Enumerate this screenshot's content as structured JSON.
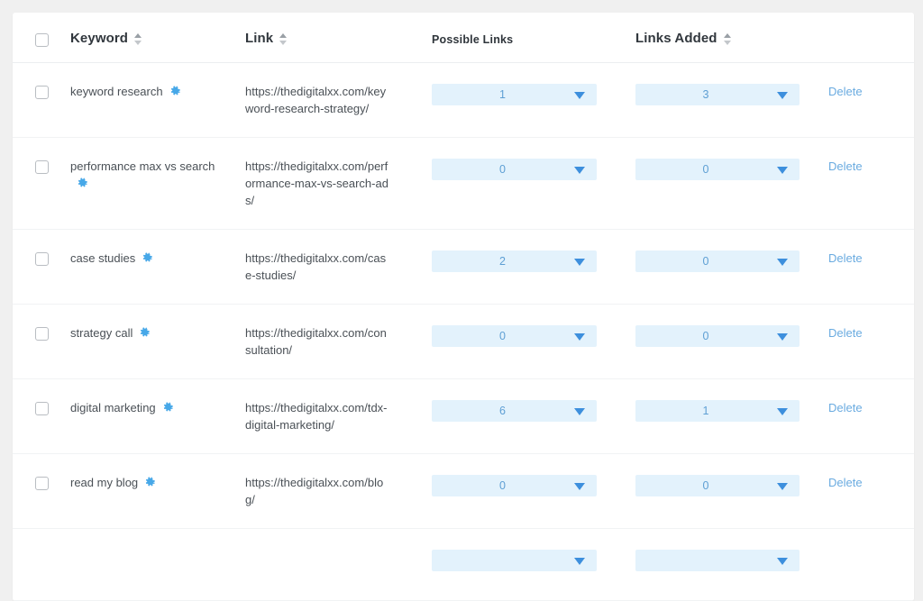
{
  "table": {
    "columns": [
      {
        "key": "select",
        "label": "",
        "sortable": false
      },
      {
        "key": "keyword",
        "label": "Keyword",
        "sortable": true
      },
      {
        "key": "link",
        "label": "Link",
        "sortable": true
      },
      {
        "key": "possible_links",
        "label": "Possible Links",
        "sortable": false
      },
      {
        "key": "links_added",
        "label": "Links Added",
        "sortable": true
      },
      {
        "key": "actions",
        "label": "",
        "sortable": false
      }
    ],
    "header_checkbox_checked": false,
    "row_action_label": "Delete",
    "settings_icon": "gear-icon",
    "sort_icon": "sort-arrows-icon",
    "rows": [
      {
        "checked": false,
        "keyword": "keyword research",
        "link": "https://thedigitalxx.com/keyword-research-strategy/",
        "possible_links": "1",
        "links_added": "3",
        "action": "Delete"
      },
      {
        "checked": false,
        "keyword": "performance max vs search",
        "link": "https://thedigitalxx.com/performance-max-vs-search-ads/",
        "possible_links": "0",
        "links_added": "0",
        "action": "Delete"
      },
      {
        "checked": false,
        "keyword": "case studies",
        "link": "https://thedigitalxx.com/case-studies/",
        "possible_links": "2",
        "links_added": "0",
        "action": "Delete"
      },
      {
        "checked": false,
        "keyword": "strategy call",
        "link": "https://thedigitalxx.com/consultation/",
        "possible_links": "0",
        "links_added": "0",
        "action": "Delete"
      },
      {
        "checked": false,
        "keyword": "digital marketing",
        "link": "https://thedigitalxx.com/tdx-digital-marketing/",
        "possible_links": "6",
        "links_added": "1",
        "action": "Delete"
      },
      {
        "checked": false,
        "keyword": "read my blog",
        "link": "https://thedigitalxx.com/blog/",
        "possible_links": "0",
        "links_added": "0",
        "action": "Delete"
      },
      {
        "checked": false,
        "keyword": "",
        "link": "",
        "possible_links": "",
        "links_added": "",
        "action": ""
      }
    ]
  },
  "colors": {
    "page_background": "#f0f0f0",
    "card_background": "#ffffff",
    "row_divider": "#f1f3f4",
    "header_text": "#31373d",
    "body_text": "#4a5056",
    "select_background": "#e3f2fc",
    "select_value_text": "#5e9fd4",
    "select_arrow": "#3d8fdd",
    "link_action": "#6aabe0",
    "gear_icon": "#47a8e8"
  }
}
